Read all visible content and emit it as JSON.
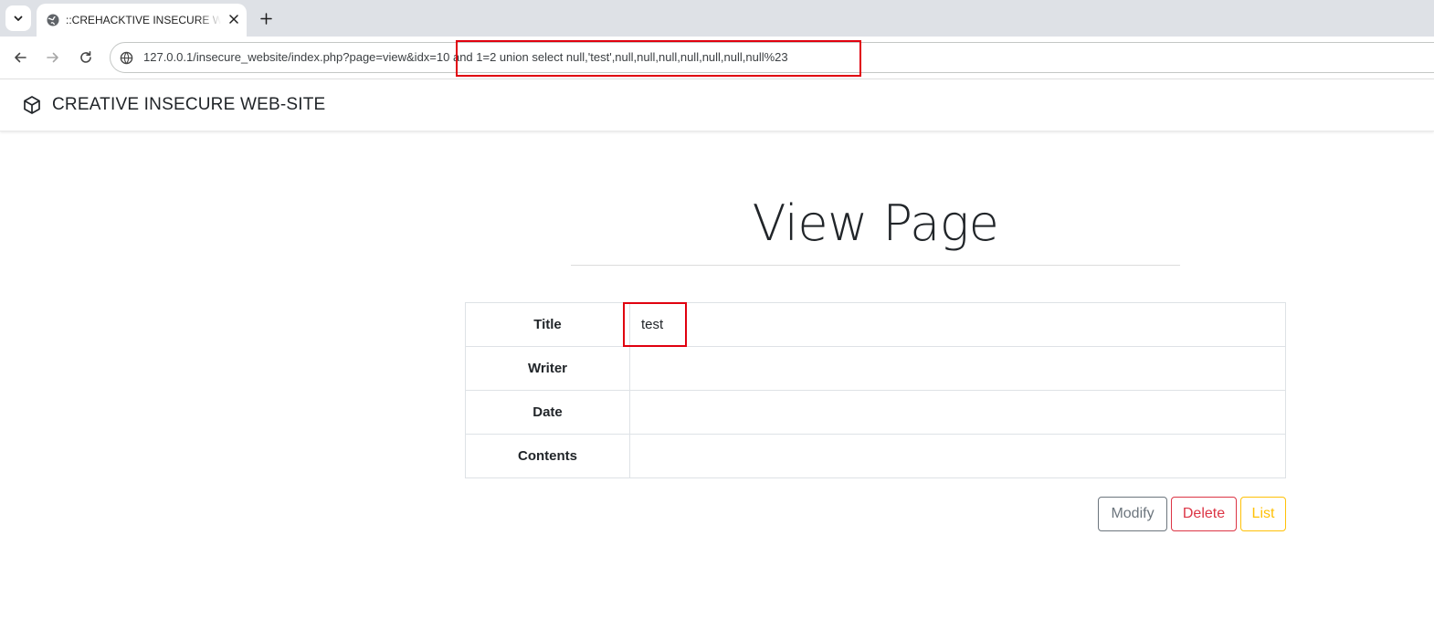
{
  "browser": {
    "tab_title": "::CREHACKTIVE INSECURE WEB-SITE",
    "url": "127.0.0.1/insecure_website/index.php?page=view&idx=10 and 1=2 union select null,'test',null,null,null,null,null,null,null%23",
    "icons": {
      "tab_search": "chevron-down-icon",
      "favicon": "globe-icon",
      "close": "close-icon",
      "new_tab": "plus-icon",
      "back": "arrow-left-icon",
      "forward": "arrow-right-icon",
      "reload": "reload-icon",
      "site_info": "site-info-icon"
    }
  },
  "site": {
    "brand": "CREATIVE INSECURE WEB-SITE",
    "brand_icon": "box-icon"
  },
  "page": {
    "title": "View Page",
    "rows": [
      {
        "label": "Title",
        "value": "test"
      },
      {
        "label": "Writer",
        "value": ""
      },
      {
        "label": "Date",
        "value": ""
      },
      {
        "label": "Contents",
        "value": ""
      }
    ],
    "buttons": {
      "modify": "Modify",
      "delete": "Delete",
      "list": "List"
    }
  },
  "colors": {
    "highlight": "#e0000f",
    "modify": "#6c757d",
    "delete": "#dc3545",
    "list": "#ffc107"
  }
}
